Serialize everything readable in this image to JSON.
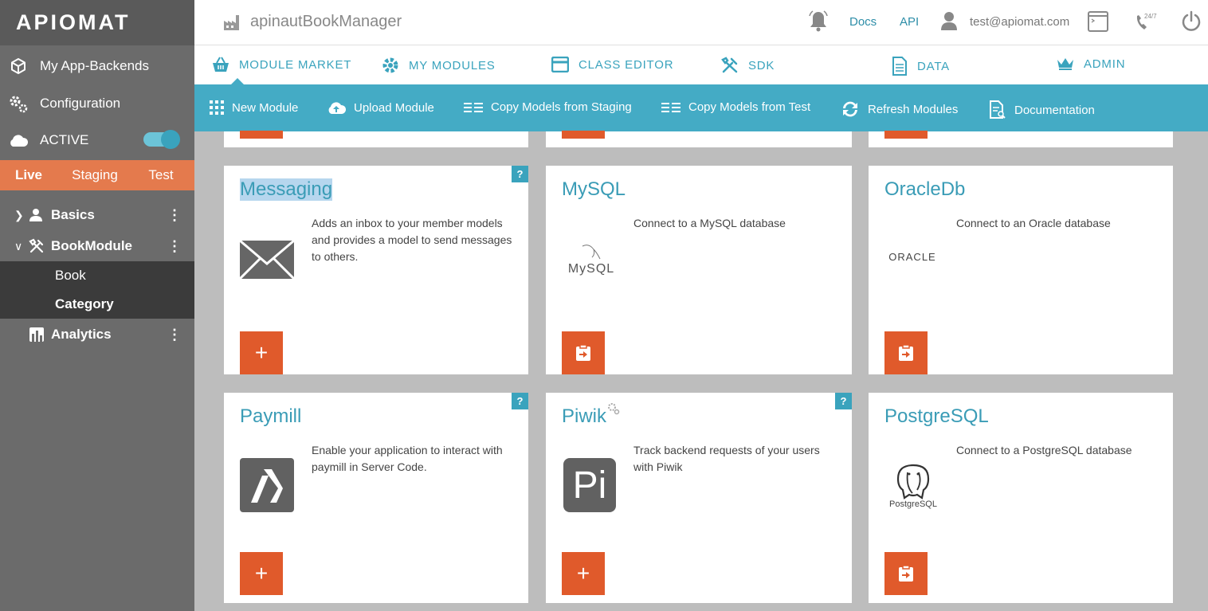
{
  "brand": "APIOMAT",
  "sidebar": {
    "my_backends": "My App-Backends",
    "configuration": "Configuration",
    "active_label": "ACTIVE",
    "env_tabs": [
      "Live",
      "Staging",
      "Test"
    ],
    "tree": {
      "basics": "Basics",
      "book_module": "BookModule",
      "book_module_children": [
        "Book",
        "Category"
      ],
      "analytics": "Analytics"
    },
    "menu_dots": "⋮"
  },
  "header": {
    "app_name": "apinautBookManager",
    "docs": "Docs",
    "api": "API",
    "user_email": "test@apiomat.com",
    "support_badge": "24/7"
  },
  "nav_tabs": [
    "MODULE MARKET",
    "MY MODULES",
    "CLASS EDITOR",
    "SDK",
    "DATA",
    "ADMIN"
  ],
  "actions": [
    "New Module",
    "Upload Module",
    "Copy Models from Staging",
    "Copy Models from Test",
    "Refresh Modules",
    "Documentation"
  ],
  "cards": [
    {
      "title": "Messaging",
      "description": "Adds an inbox to your member models and provides a model to send messages to others.",
      "button": "+",
      "help": "?",
      "logo": "envelope-icon"
    },
    {
      "title": "MySQL",
      "description": "Connect to a MySQL database",
      "logo_text": "MySQL",
      "button": "import",
      "logo": "mysql-logo"
    },
    {
      "title": "OracleDb",
      "description": "Connect to an Oracle database",
      "logo_text": "ORACLE",
      "button": "import",
      "logo": "oracle-logo"
    },
    {
      "title": "Paymill",
      "description": "Enable your application to interact with paymill in Server Code.",
      "button": "+",
      "help": "?",
      "logo": "paymill-logo"
    },
    {
      "title": "Piwik",
      "description": "Track backend requests of your users with Piwik",
      "logo_text": "Pi",
      "button": "+",
      "help": "?",
      "logo": "piwik-logo"
    },
    {
      "title": "PostgreSQL",
      "description": "Connect to a PostgreSQL database",
      "logo_text": "PostgreSQL",
      "button": "import",
      "logo": "postgresql-logo"
    }
  ],
  "colors": {
    "accent": "#44abc5",
    "orange": "#e05a2b",
    "env_bar": "#e47a4d",
    "sidebar": "#6b6b6b"
  }
}
